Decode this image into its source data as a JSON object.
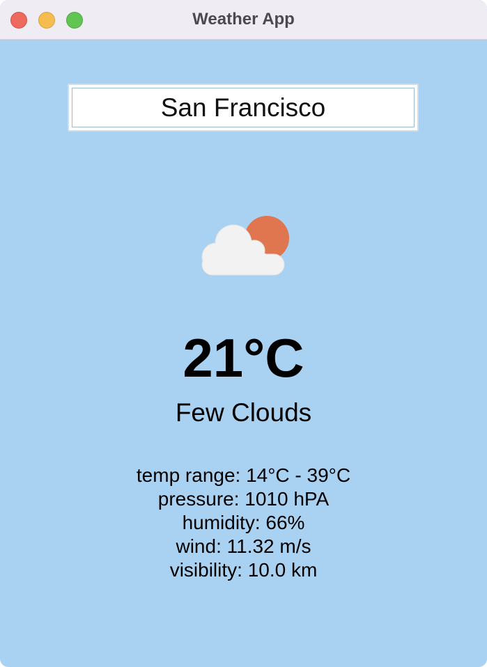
{
  "window": {
    "title": "Weather App"
  },
  "search": {
    "value": "San Francisco"
  },
  "weather": {
    "icon": "few-clouds-icon",
    "temperature": "21°C",
    "condition": "Few Clouds"
  },
  "details": {
    "temp_range": "temp range: 14°C - 39°C",
    "pressure": "pressure: 1010 hPA",
    "humidity": "humidity: 66%",
    "wind": "wind: 11.32 m/s",
    "visibility": "visibility: 10.0 km"
  },
  "colors": {
    "background": "#a9d2f2",
    "titlebar": "#efedf3",
    "sun": "#e07650",
    "cloud": "#f2f2f2"
  }
}
